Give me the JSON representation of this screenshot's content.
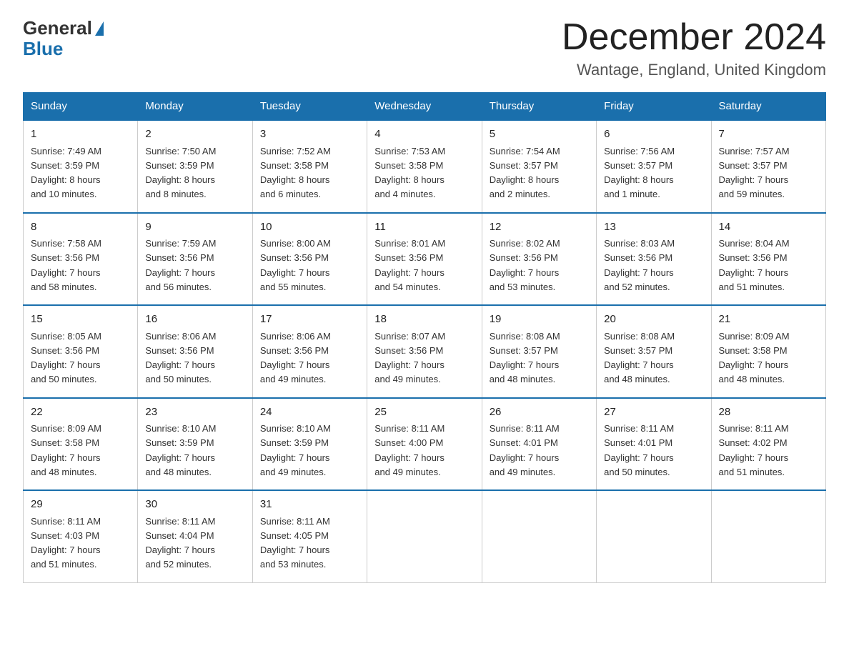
{
  "header": {
    "logo_general": "General",
    "logo_blue": "Blue",
    "title": "December 2024",
    "location": "Wantage, England, United Kingdom"
  },
  "columns": [
    "Sunday",
    "Monday",
    "Tuesday",
    "Wednesday",
    "Thursday",
    "Friday",
    "Saturday"
  ],
  "weeks": [
    [
      {
        "day": "1",
        "info": "Sunrise: 7:49 AM\nSunset: 3:59 PM\nDaylight: 8 hours\nand 10 minutes."
      },
      {
        "day": "2",
        "info": "Sunrise: 7:50 AM\nSunset: 3:59 PM\nDaylight: 8 hours\nand 8 minutes."
      },
      {
        "day": "3",
        "info": "Sunrise: 7:52 AM\nSunset: 3:58 PM\nDaylight: 8 hours\nand 6 minutes."
      },
      {
        "day": "4",
        "info": "Sunrise: 7:53 AM\nSunset: 3:58 PM\nDaylight: 8 hours\nand 4 minutes."
      },
      {
        "day": "5",
        "info": "Sunrise: 7:54 AM\nSunset: 3:57 PM\nDaylight: 8 hours\nand 2 minutes."
      },
      {
        "day": "6",
        "info": "Sunrise: 7:56 AM\nSunset: 3:57 PM\nDaylight: 8 hours\nand 1 minute."
      },
      {
        "day": "7",
        "info": "Sunrise: 7:57 AM\nSunset: 3:57 PM\nDaylight: 7 hours\nand 59 minutes."
      }
    ],
    [
      {
        "day": "8",
        "info": "Sunrise: 7:58 AM\nSunset: 3:56 PM\nDaylight: 7 hours\nand 58 minutes."
      },
      {
        "day": "9",
        "info": "Sunrise: 7:59 AM\nSunset: 3:56 PM\nDaylight: 7 hours\nand 56 minutes."
      },
      {
        "day": "10",
        "info": "Sunrise: 8:00 AM\nSunset: 3:56 PM\nDaylight: 7 hours\nand 55 minutes."
      },
      {
        "day": "11",
        "info": "Sunrise: 8:01 AM\nSunset: 3:56 PM\nDaylight: 7 hours\nand 54 minutes."
      },
      {
        "day": "12",
        "info": "Sunrise: 8:02 AM\nSunset: 3:56 PM\nDaylight: 7 hours\nand 53 minutes."
      },
      {
        "day": "13",
        "info": "Sunrise: 8:03 AM\nSunset: 3:56 PM\nDaylight: 7 hours\nand 52 minutes."
      },
      {
        "day": "14",
        "info": "Sunrise: 8:04 AM\nSunset: 3:56 PM\nDaylight: 7 hours\nand 51 minutes."
      }
    ],
    [
      {
        "day": "15",
        "info": "Sunrise: 8:05 AM\nSunset: 3:56 PM\nDaylight: 7 hours\nand 50 minutes."
      },
      {
        "day": "16",
        "info": "Sunrise: 8:06 AM\nSunset: 3:56 PM\nDaylight: 7 hours\nand 50 minutes."
      },
      {
        "day": "17",
        "info": "Sunrise: 8:06 AM\nSunset: 3:56 PM\nDaylight: 7 hours\nand 49 minutes."
      },
      {
        "day": "18",
        "info": "Sunrise: 8:07 AM\nSunset: 3:56 PM\nDaylight: 7 hours\nand 49 minutes."
      },
      {
        "day": "19",
        "info": "Sunrise: 8:08 AM\nSunset: 3:57 PM\nDaylight: 7 hours\nand 48 minutes."
      },
      {
        "day": "20",
        "info": "Sunrise: 8:08 AM\nSunset: 3:57 PM\nDaylight: 7 hours\nand 48 minutes."
      },
      {
        "day": "21",
        "info": "Sunrise: 8:09 AM\nSunset: 3:58 PM\nDaylight: 7 hours\nand 48 minutes."
      }
    ],
    [
      {
        "day": "22",
        "info": "Sunrise: 8:09 AM\nSunset: 3:58 PM\nDaylight: 7 hours\nand 48 minutes."
      },
      {
        "day": "23",
        "info": "Sunrise: 8:10 AM\nSunset: 3:59 PM\nDaylight: 7 hours\nand 48 minutes."
      },
      {
        "day": "24",
        "info": "Sunrise: 8:10 AM\nSunset: 3:59 PM\nDaylight: 7 hours\nand 49 minutes."
      },
      {
        "day": "25",
        "info": "Sunrise: 8:11 AM\nSunset: 4:00 PM\nDaylight: 7 hours\nand 49 minutes."
      },
      {
        "day": "26",
        "info": "Sunrise: 8:11 AM\nSunset: 4:01 PM\nDaylight: 7 hours\nand 49 minutes."
      },
      {
        "day": "27",
        "info": "Sunrise: 8:11 AM\nSunset: 4:01 PM\nDaylight: 7 hours\nand 50 minutes."
      },
      {
        "day": "28",
        "info": "Sunrise: 8:11 AM\nSunset: 4:02 PM\nDaylight: 7 hours\nand 51 minutes."
      }
    ],
    [
      {
        "day": "29",
        "info": "Sunrise: 8:11 AM\nSunset: 4:03 PM\nDaylight: 7 hours\nand 51 minutes."
      },
      {
        "day": "30",
        "info": "Sunrise: 8:11 AM\nSunset: 4:04 PM\nDaylight: 7 hours\nand 52 minutes."
      },
      {
        "day": "31",
        "info": "Sunrise: 8:11 AM\nSunset: 4:05 PM\nDaylight: 7 hours\nand 53 minutes."
      },
      {
        "day": "",
        "info": ""
      },
      {
        "day": "",
        "info": ""
      },
      {
        "day": "",
        "info": ""
      },
      {
        "day": "",
        "info": ""
      }
    ]
  ]
}
